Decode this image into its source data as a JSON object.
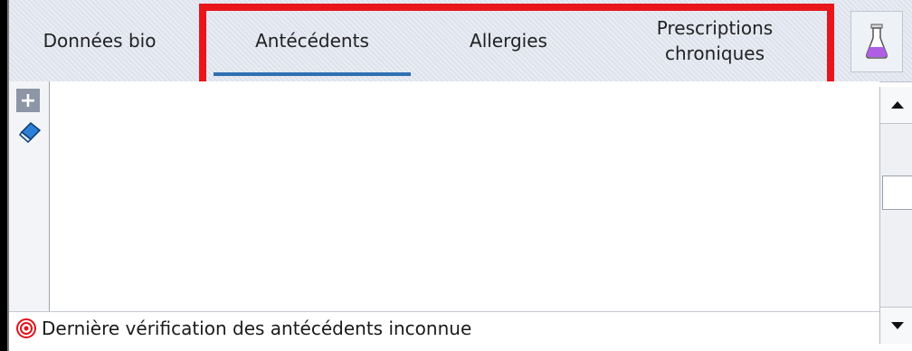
{
  "tabs": [
    {
      "label": "Données bio",
      "active": false
    },
    {
      "label": "Antécédents",
      "active": true
    },
    {
      "label": "Allergies",
      "active": false
    },
    {
      "label": "Prescriptions\nchroniques",
      "active": false
    }
  ],
  "icons": {
    "add": "plus-icon",
    "eraser": "eraser-icon",
    "flask": "flask-icon",
    "status": "target-icon",
    "scroll_up": "arrow-up-icon",
    "scroll_down": "arrow-down-icon"
  },
  "add_label": "+",
  "status": {
    "text": "Dernière vérification des antécédents inconnue"
  },
  "colors": {
    "highlight": "#e8151b",
    "active_tab_underline": "#2f6fb4",
    "flask": "#b05ee6",
    "status_icon": "#e1141b"
  }
}
